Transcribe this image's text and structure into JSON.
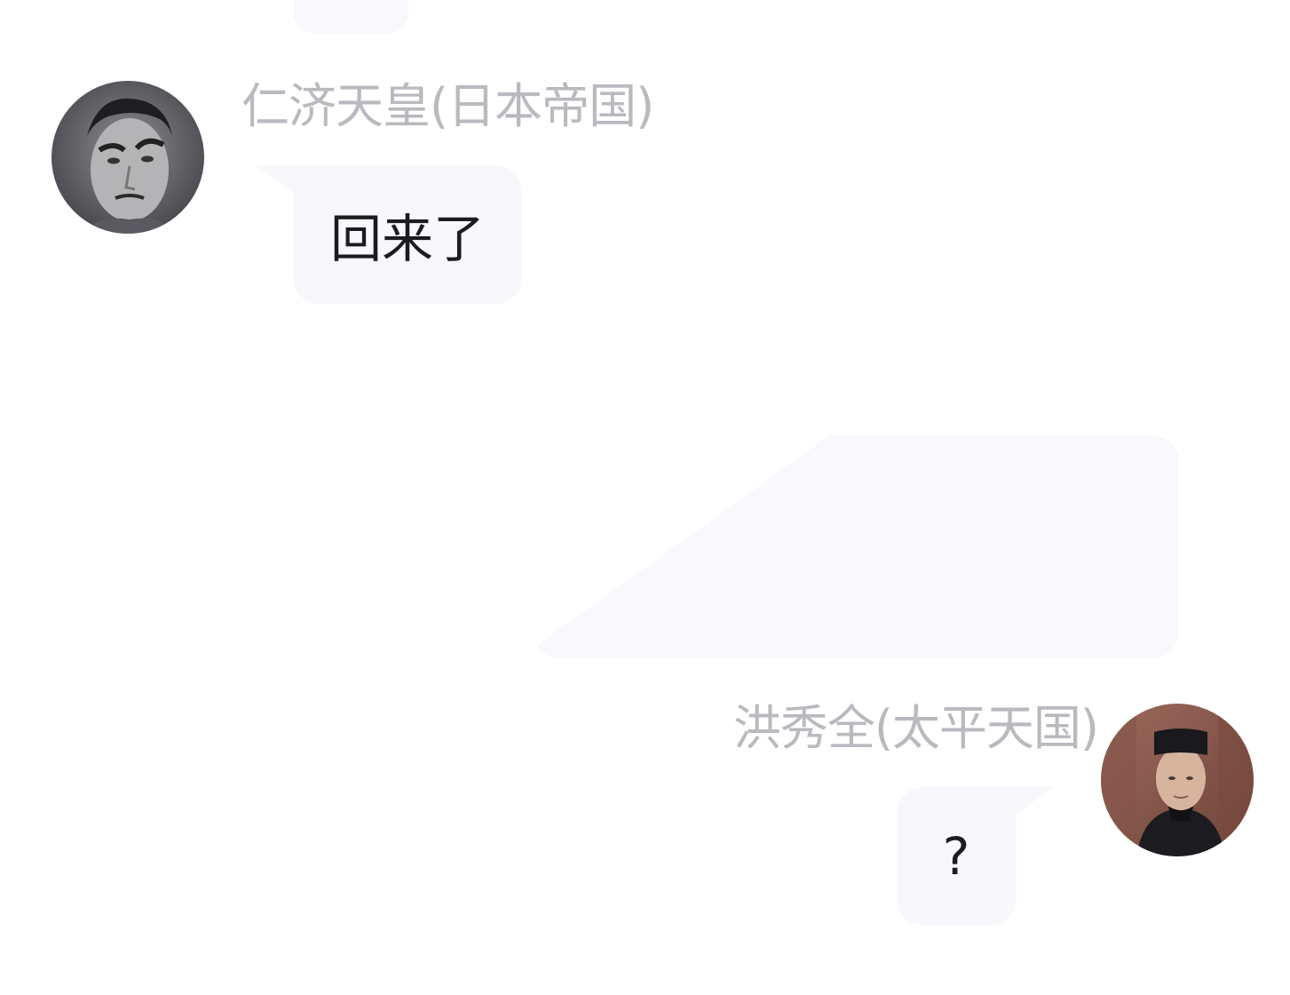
{
  "chat": {
    "messages": [
      {
        "side": "left",
        "sender": "仁济天皇(日本帝国)",
        "text": "回来了",
        "avatar_icon": "portrait-avatar-icon"
      },
      {
        "side": "right",
        "sender": "洪秀全(太平天国)",
        "text": "?",
        "avatar_icon": "portrait-avatar-icon"
      }
    ]
  },
  "colors": {
    "background": "#ffffff",
    "bubble": "#f7f7fc",
    "sender_name": "#b9b9bf",
    "message_text": "#1c1c1e"
  }
}
